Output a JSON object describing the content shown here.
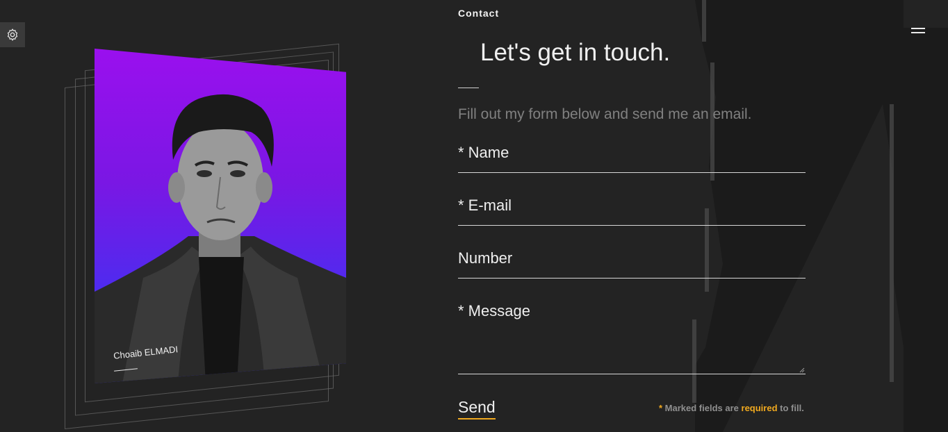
{
  "header": {
    "section_label": "Contact",
    "settings_icon": "gear-icon",
    "menu_icon": "hamburger-menu-icon"
  },
  "main": {
    "heading": "Let's get in touch.",
    "subtext": "Fill out my form below and send me an email.",
    "form": {
      "name_label": "* Name",
      "email_label": "* E-mail",
      "number_label": "Number",
      "message_label": "* Message",
      "send_label": "Send"
    },
    "note": {
      "asterisk": "*",
      "part1": " Marked fields are ",
      "required": "required",
      "part2": " to fill."
    }
  },
  "photo": {
    "caption": "Choaib ELMADI"
  },
  "colors": {
    "background": "#232323",
    "accent": "#f0a91f",
    "photo_top": "#9a10ee",
    "photo_bottom": "#3b30f5"
  }
}
